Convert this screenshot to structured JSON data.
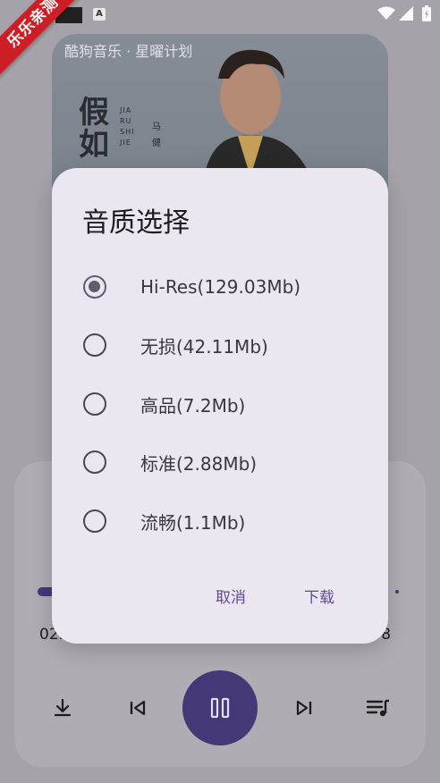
{
  "status_bar": {
    "notification_icon": "a-icon",
    "wifi_icon": "wifi-icon",
    "signal_icon": "signal-icon",
    "battery_icon": "battery-icon"
  },
  "watermark": {
    "text": "乐乐亲测"
  },
  "album": {
    "caption": "酷狗音乐 · 星曜计划",
    "cover_title": "假如",
    "cover_latin": "JIA\nRU\nSHI\nJIE",
    "cover_artist": "马健"
  },
  "player": {
    "progress": 0.05,
    "time_elapsed": "02.",
    "time_total": ".08",
    "accent_color": "#463a7a"
  },
  "dialog": {
    "title": "音质选择",
    "options": [
      {
        "label": "Hi-Res(129.03Mb)",
        "selected": true
      },
      {
        "label": "无损(42.11Mb)",
        "selected": false
      },
      {
        "label": "高品(7.2Mb)",
        "selected": false
      },
      {
        "label": "标准(2.88Mb)",
        "selected": false
      },
      {
        "label": "流畅(1.1Mb)",
        "selected": false
      }
    ],
    "cancel_label": "取消",
    "confirm_label": "下载"
  }
}
